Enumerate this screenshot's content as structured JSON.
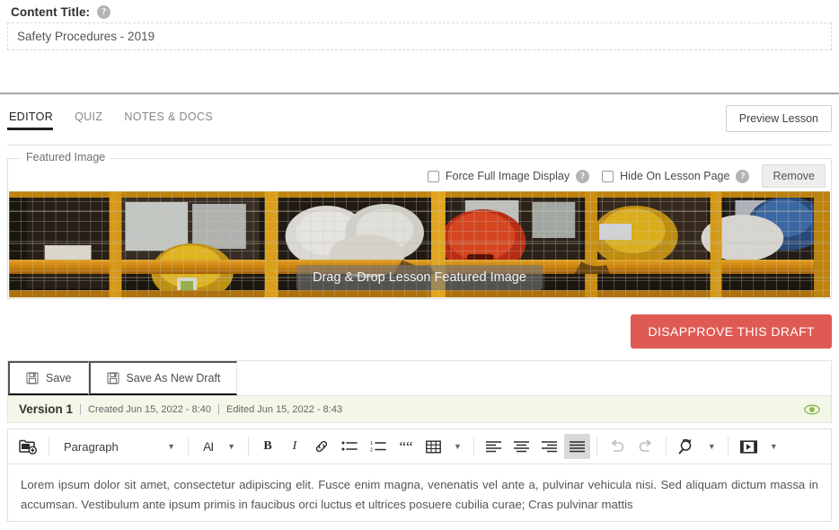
{
  "title_section": {
    "label": "Content Title:",
    "help_icon": "help-circle-icon",
    "value": "Safety Procedures - 2019",
    "placeholder": "Content Title"
  },
  "tabs": [
    {
      "label": "EDITOR",
      "active": true
    },
    {
      "label": "QUIZ",
      "active": false
    },
    {
      "label": "NOTES & DOCS",
      "active": false
    }
  ],
  "preview_button": {
    "label": "Preview Lesson"
  },
  "featured_image": {
    "legend": "Featured Image",
    "options": [
      {
        "label": "Force Full Image Display",
        "checked": false,
        "help_icon": "help-circle-icon"
      },
      {
        "label": "Hide On Lesson Page",
        "checked": false,
        "help_icon": "help-circle-icon"
      }
    ],
    "remove_label": "Remove",
    "dropzone_label": "Drag & Drop Lesson Featured Image",
    "alt": "Construction site hard hats stacked behind orange steel cage"
  },
  "disapprove_button": {
    "label": "DISAPPROVE THIS DRAFT",
    "color": "#e05a54"
  },
  "save_bar": {
    "save_label": "Save",
    "save_as_new_draft_label": "Save As New Draft",
    "icon": "floppy-disk-icon"
  },
  "version_bar": {
    "name": "Version 1",
    "separator": "|",
    "created": "Created Jun 15, 2022 - 8:40",
    "edited": "Edited Jun 15, 2022 - 8:43",
    "view_icon": "eye-icon",
    "background": "#f3f7e8",
    "icon_color": "#8cb84a"
  },
  "editor_toolbar": {
    "insert_icon": "insert-media-folder-icon",
    "block_format": {
      "value": "Paragraph",
      "caret": "chevron-down-icon"
    },
    "font_size": {
      "label": "AI",
      "icon": "font-size-icon",
      "caret": "chevron-down-icon"
    },
    "bold": "B",
    "italic": "I",
    "link_icon": "link-icon",
    "bullet_list_icon": "bullet-list-icon",
    "numbered_list_icon": "numbered-list-icon",
    "blockquote": "““",
    "table_icon": "table-icon",
    "table_caret": "chevron-down-icon",
    "align_left_icon": "align-left-icon",
    "align_center_icon": "align-center-icon",
    "align_right_icon": "align-right-icon",
    "align_justify_icon": "align-justify-icon",
    "align_active": "align-justify-icon",
    "undo_icon": "undo-icon",
    "redo_icon": "redo-icon",
    "find_replace_icon": "find-replace-icon",
    "find_replace_caret": "chevron-down-icon",
    "media_icon": "media-embed-icon",
    "media_caret": "chevron-down-icon"
  },
  "editor_body": {
    "paragraph": "Lorem ipsum dolor sit amet, consectetur adipiscing elit. Fusce enim magna, venenatis vel ante a, pulvinar vehicula nisi. Sed aliquam dictum massa in accumsan. Vestibulum ante ipsum primis in faucibus orci luctus et ultrices posuere cubilia curae; Cras pulvinar mattis"
  }
}
